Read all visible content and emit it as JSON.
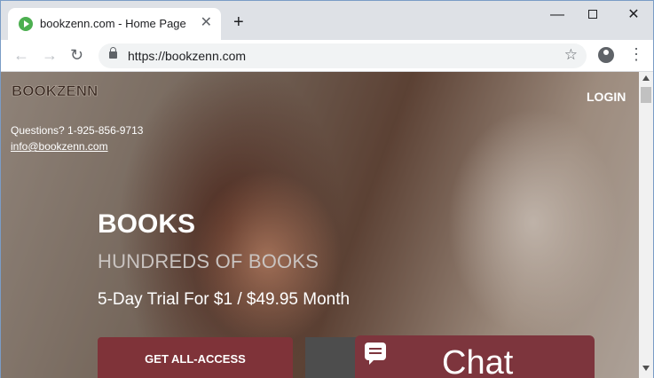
{
  "browser": {
    "tab_title": "bookzenn.com - Home Page",
    "tab_close": "✕",
    "new_tab": "+",
    "url": "https://bookzenn.com",
    "window_min": "—",
    "window_close": "✕",
    "back": "←",
    "forward": "→",
    "reload": "↻",
    "star": "☆",
    "menu": "⋮"
  },
  "site": {
    "logo": "BOOKZENN",
    "login": "LOGIN",
    "questions": "Questions? 1-925-856-9713",
    "email": "info@bookzenn.com",
    "hero_title": "BOOKS",
    "hero_subtitle": "HUNDREDS OF BOOKS",
    "hero_price": "5-Day Trial For $1 / $49.95 Month",
    "cta_label": "GET ALL-ACCESS",
    "chat_label": "Chat"
  },
  "colors": {
    "accent": "#7f3339",
    "chat_bg": "#7d353d"
  }
}
